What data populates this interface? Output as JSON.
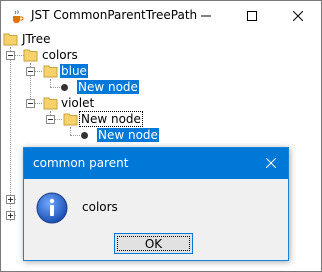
{
  "window": {
    "title": "JST CommonParentTreePath",
    "icon": "java-cup-icon",
    "controls": [
      "minimize-icon",
      "maximize-icon",
      "close-icon"
    ]
  },
  "tree": {
    "root": "JTree",
    "colors": "colors",
    "blue": "blue",
    "blue_child": "New node",
    "violet": "violet",
    "violet_child": "New node",
    "violet_grandchild": "New node",
    "selection_color": "#0078d7"
  },
  "dialog": {
    "title": "common parent",
    "icon": "information-icon",
    "message": "colors",
    "ok_label": "OK",
    "accent": "#0078d7"
  }
}
